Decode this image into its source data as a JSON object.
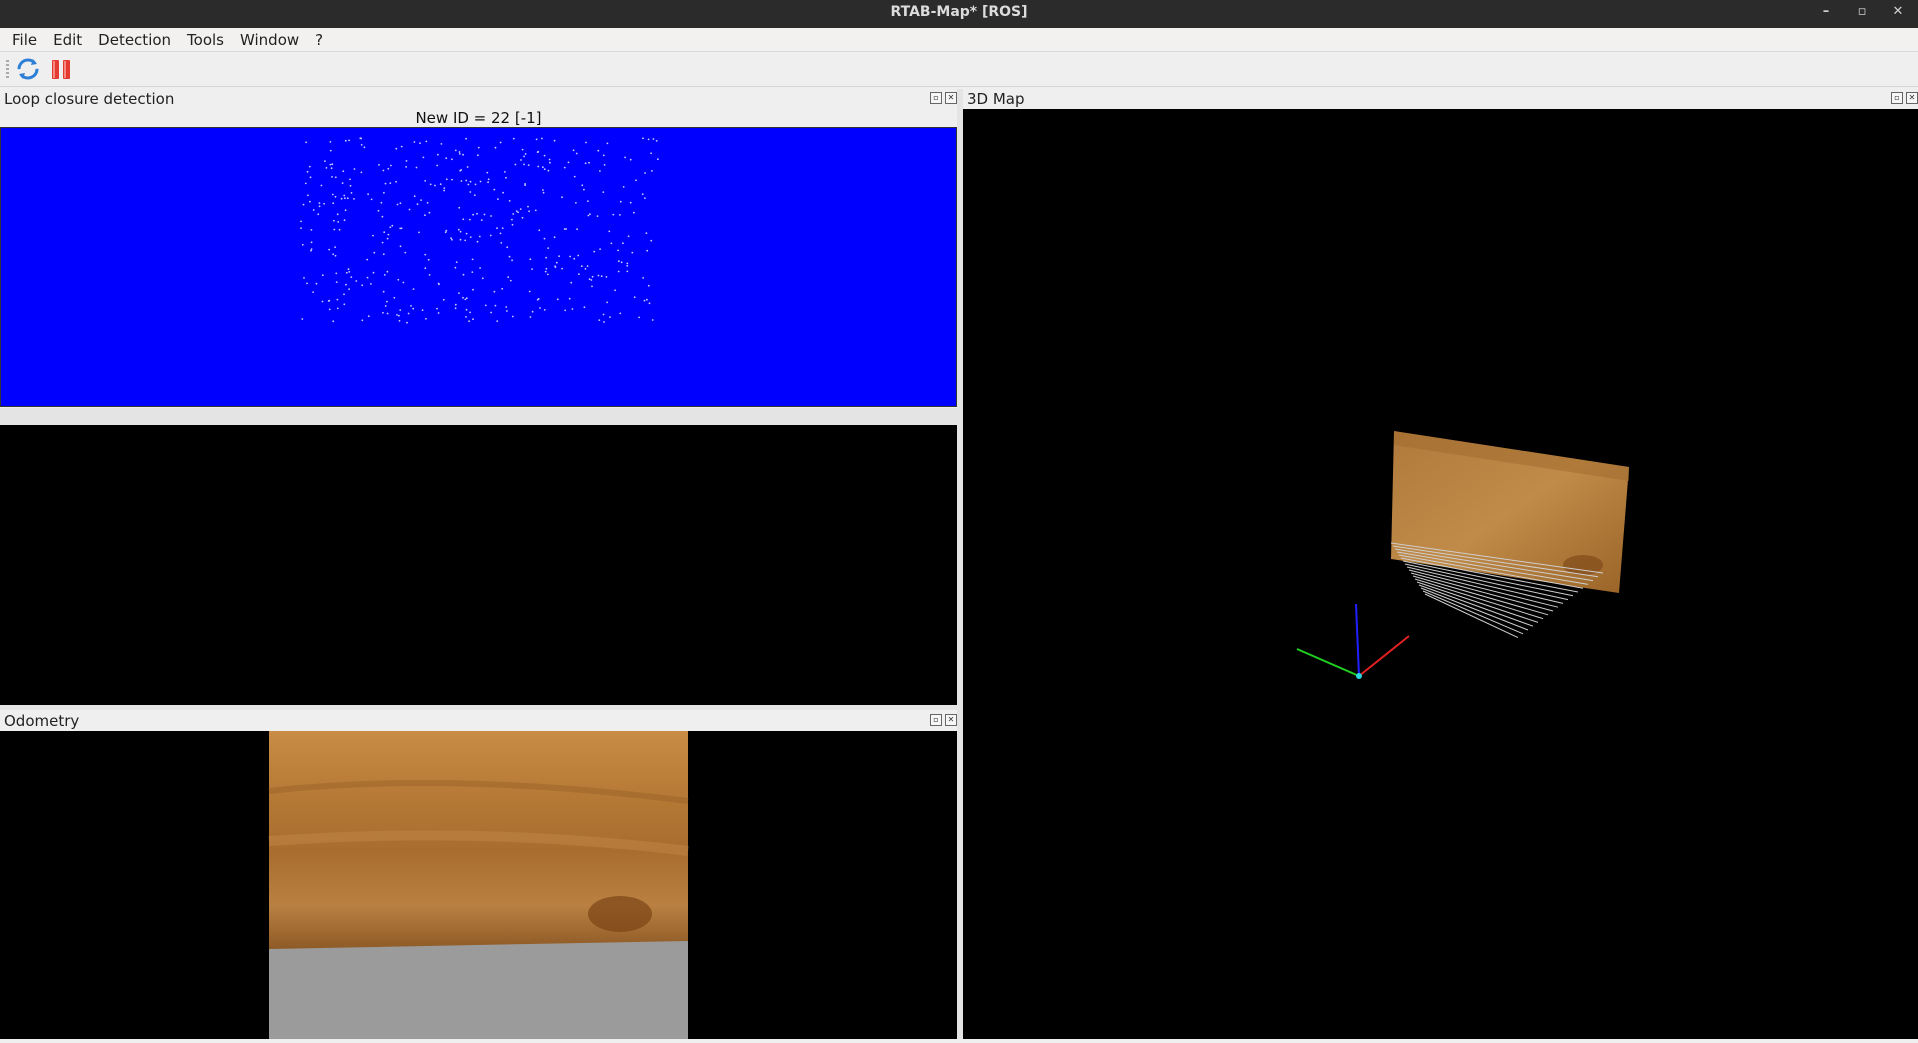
{
  "window": {
    "title": "RTAB-Map* [ROS]",
    "controls": {
      "minimize": "–",
      "restore": "▫",
      "close": "✕"
    }
  },
  "menu": [
    "File",
    "Edit",
    "Detection",
    "Tools",
    "Window",
    "?"
  ],
  "toolbar": {
    "items": [
      {
        "icon": "refresh-icon",
        "color": "#2e7fd6"
      },
      {
        "icon": "pause-icon",
        "color": "#e53a2f"
      }
    ]
  },
  "docks": {
    "loop_closure": {
      "title": "Loop closure detection",
      "new_id_label": "New ID = 22 [-1]",
      "image_color": "#0000ff"
    },
    "odometry": {
      "title": "Odometry"
    },
    "map3d": {
      "title": "3D Map"
    }
  },
  "dock_buttons": {
    "float": "▫",
    "close": "✕"
  },
  "colors": {
    "titlebar_bg": "#2b2b2b",
    "panel_bg": "#000000",
    "wood": "#b07a3c",
    "floor_gray": "#9b9b9b",
    "axis_x": "#e02020",
    "axis_y": "#20d020",
    "axis_z": "#2020ff"
  }
}
